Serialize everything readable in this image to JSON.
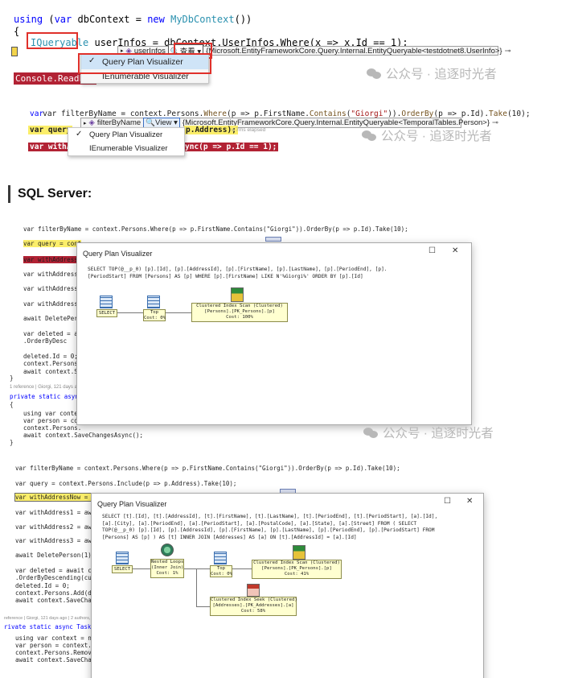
{
  "panel1": {
    "code": {
      "l1_kw1": "using",
      "l1_rest1": " (",
      "l1_kw2": "var",
      "l1_rest2": " dbContext = ",
      "l1_kw3": "new",
      "l1_sp": " ",
      "l1_type": "MyDbContext",
      "l1_end": "())",
      "l2": "{",
      "l3_type": "IQueryable",
      "l3_rest": " userInfos = dbContext.UserInfos.Where(x => x.Id == 1);",
      "l4_tail": "Console.ReadLin"
    },
    "tip": {
      "var_name": "userInfos",
      "view_label": "查看",
      "value": "{Microsoft.EntityFrameworkCore.Query.Internal.EntityQueryable<testdotnet8.UserInfo>}",
      "pin": "⊣"
    },
    "menu": {
      "items": [
        {
          "label": "Query Plan Visualizer",
          "checked": true
        },
        {
          "label": "IEnumerable Visualizer",
          "checked": false
        }
      ]
    },
    "watermark": "公众号 · 追逐时光者"
  },
  "panel2": {
    "code": {
      "l1_a": "var filterByName = context.Persons.",
      "l1_where": "Where",
      "l1_b": "(p => p.FirstName.",
      "l1_contains": "Contains",
      "l1_c": "(",
      "l1_str": "\"Giorgi\"",
      "l1_d": ")).",
      "l1_order": "OrderBy",
      "l1_e": "(p => p.Id).",
      "l1_take": "Take",
      "l1_f": "(10);",
      "l2_a": "var query",
      "l2_b": "p.Address);",
      "l2_elapsed": "≤ 7ms elapsed",
      "l3_a": "var withAd",
      "l3_b": "ync(p => p.Id == 1);"
    },
    "tip": {
      "var_name": "filterByName",
      "view_label": "View",
      "value": "{Microsoft.EntityFrameworkCore.Query.Internal.EntityQueryable<TemporalTables.Person>}"
    },
    "menu": {
      "items": [
        {
          "label": "Query Plan Visualizer",
          "checked": true
        },
        {
          "label": "IEnumerable Visualizer",
          "checked": false
        }
      ]
    },
    "watermark": "公众号 · 追逐时光者"
  },
  "heading": "SQL Server:",
  "panel3": {
    "code_lines": [
      "var filterByName = context.Persons.Where(p => p.FirstName.Contains(\"Giorgi\")).OrderBy(p => p.Id).Take(10);",
      "var query = cont",
      "var withAddress",
      "var withAddress1",
      "var withAddress2",
      "var withAddress3",
      "await DeletePers",
      "var deleted = awa",
      "    .OrderByDesc",
      "deleted.Id = 0;",
      "context.Persons.",
      "await context.Sa",
      "}",
      "1 reference | Giorgi, 121 days a",
      "private static async",
      "{",
      "    using var contex",
      "    var person = cor",
      "    context.Persons.",
      "    await context.SaveChangesAsync();",
      "}"
    ],
    "window": {
      "title": "Query Plan Visualizer",
      "min": "☐",
      "close": "✕",
      "sql": "SELECT TOP(@__p_0) [p].[Id], [p].[AddressId], [p].[FirstName], [p].[LastName], [p].[PeriodEnd], [p].\n[PeriodStart] FROM [Persons] AS [p] WHERE [p].[FirstName] LIKE N'%Giorgi%' ORDER BY [p].[Id]",
      "nodes": {
        "select": "SELECT",
        "top": [
          "Top",
          "Cost: 0%"
        ],
        "scan": [
          "Clustered Index Scan (Clustered)",
          "[Persons].[PK_Persons].[p]",
          "Cost: 100%"
        ]
      }
    },
    "watermark": "公众号 · 追逐时光者"
  },
  "panel4": {
    "code_lines": [
      "var filterByName = context.Persons.Where(p => p.FirstName.Contains(\"Giorgi\")).OrderBy(p => p.Id).Take(10);",
      "var query = context.Persons.Include(p => p.Address).Take(10);",
      "var withAddressNow = awai",
      "var withAddress1 = await",
      "var withAddress2 = await",
      "var withAddress3 = await",
      "await DeletePerson(1);",
      "var deleted = await conte",
      "    .OrderByDescending(cu",
      "deleted.Id = 0;",
      "context.Persons.Add(delet",
      "await context.SaveChanges",
      "reference | Giorgi, 121 days ago | 2 authors,",
      "rivate static async Task Del",
      "    using var context = new T",
      "    var person = context.Pers",
      "    context.Persons.Remove(pe",
      "    await context.SaveChanges"
    ],
    "window": {
      "title": "Query Plan Visualizer",
      "min": "☐",
      "close": "✕",
      "sql": "SELECT [t].[Id], [t].[AddressId], [t].[FirstName], [t].[LastName], [t].[PeriodEnd], [t].[PeriodStart], [a].[Id],\n[a].[City], [a].[PeriodEnd], [a].[PeriodStart], [a].[PostalCode], [a].[State], [a].[Street] FROM ( SELECT\nTOP(@__p_0) [p].[Id], [p].[AddressId], [p].[FirstName], [p].[LastName], [p].[PeriodEnd], [p].[PeriodStart] FROM\n[Persons] AS [p] ) AS [t] INNER JOIN [Addresses] AS [a] ON [t].[AddressId] = [a].[Id]",
      "nodes": {
        "select": "SELECT",
        "loops": [
          "Nested Loops",
          "(Inner Join)",
          "Cost: 1%"
        ],
        "top": [
          "Top",
          "Cost: 0%"
        ],
        "scan": [
          "Clustered Index Scan (Clustered)",
          "[Persons].[PK_Persons].[p]",
          "Cost: 41%"
        ],
        "seek": [
          "Clustered Index Seek (Clustered)",
          "[Addresses].[PK_Addresses].[a]",
          "Cost: 58%"
        ]
      }
    }
  },
  "colors": {
    "highlight_yellow": "#fbee6a",
    "highlight_red": "#b22234",
    "annotation_red": "#e0302a",
    "node_fill": "#ffffd0"
  }
}
